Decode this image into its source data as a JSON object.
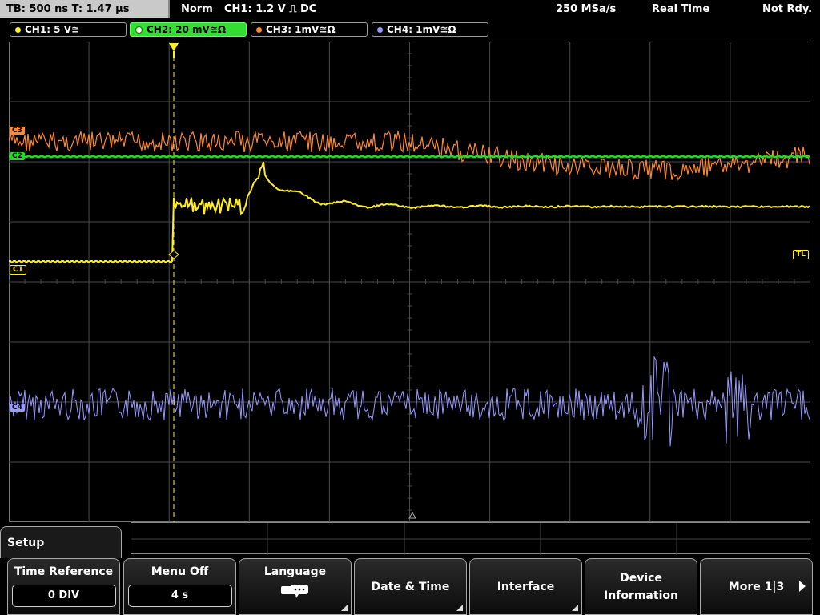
{
  "topbar": {
    "timebase": "TB: 500 ns   T: 1.47 µs",
    "mode": "Norm",
    "trigger": "CH1: 1.2 V ⎍ DC",
    "sample_rate": "250 MSa/s",
    "acq": "Real Time",
    "status": "Not Rdy."
  },
  "channels": [
    {
      "label": "CH1: 5 V≅",
      "color": "#ffee22"
    },
    {
      "label": "CH2: 20 mV≅Ω",
      "color": "#22dd22"
    },
    {
      "label": "CH3: 1mV≅Ω",
      "color": "#ff8833"
    },
    {
      "label": "CH4: 1mV≅Ω",
      "color": "#9999ff"
    }
  ],
  "markers": {
    "c1": "C1",
    "c2": "C2",
    "c3": "C3",
    "c4": "C4",
    "tl": "TL"
  },
  "menu": {
    "title": "Setup",
    "softkeys": [
      {
        "label": "Time Reference",
        "value": "0 DIV"
      },
      {
        "label": "Menu Off",
        "value": "4 s"
      },
      {
        "label": "Language",
        "icon": "speech-bubbles-icon"
      },
      {
        "label": "Date & Time"
      },
      {
        "label": "Interface"
      },
      {
        "label": "Device",
        "label2": "Information"
      },
      {
        "label": "More 1|3",
        "icon": "play-arrow-icon"
      }
    ]
  }
}
